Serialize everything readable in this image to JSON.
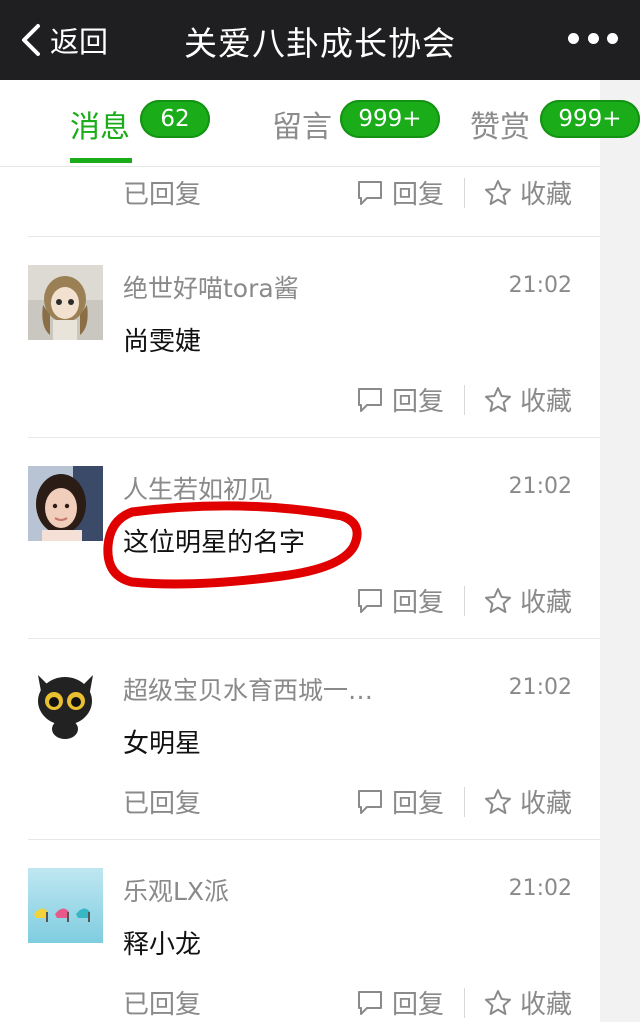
{
  "header": {
    "back_label": "返回",
    "title": "关爱八卦成长协会",
    "more_icon": "more-dots-icon"
  },
  "tabs": [
    {
      "label": "消息",
      "badge": "62",
      "active": true
    },
    {
      "label": "留言",
      "badge": "999+",
      "active": false
    },
    {
      "label": "赞赏",
      "badge": "999+",
      "active": false
    }
  ],
  "actions": {
    "reply_label": "回复",
    "favorite_label": "收藏",
    "replied_label": "已回复"
  },
  "messages": [
    {
      "name": "",
      "time": "",
      "text": "",
      "status": "已回复"
    },
    {
      "name": "绝世好喵tora酱",
      "time": "21:02",
      "text": "尚雯婕",
      "status": ""
    },
    {
      "name": "人生若如初见",
      "time": "21:02",
      "text": "这位明星的名字",
      "status": ""
    },
    {
      "name": "超级宝贝水育西城一…",
      "time": "21:02",
      "text": "女明星",
      "status": "已回复"
    },
    {
      "name": "乐观LX派",
      "time": "21:02",
      "text": "释小龙",
      "status": "已回复"
    }
  ],
  "colors": {
    "accent": "#1aad19",
    "topbar": "#1f1f21",
    "annotation": "#e00000"
  }
}
